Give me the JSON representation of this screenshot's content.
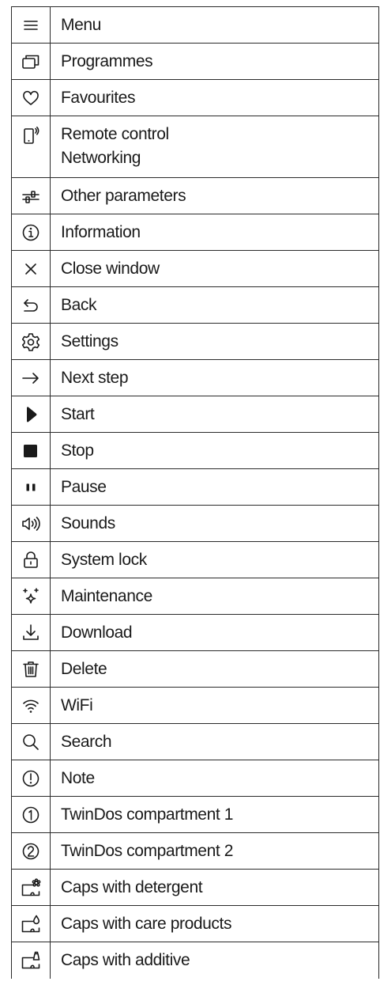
{
  "rows": [
    {
      "icon": "menu-icon",
      "label": "Menu"
    },
    {
      "icon": "programmes-icon",
      "label": "Programmes"
    },
    {
      "icon": "heart-icon",
      "label": "Favourites"
    },
    {
      "icon": "remote-control-icon",
      "label": "Remote control",
      "label2": "Networking"
    },
    {
      "icon": "parameters-icon",
      "label": "Other parameters"
    },
    {
      "icon": "information-icon",
      "label": "Information"
    },
    {
      "icon": "close-icon",
      "label": "Close window"
    },
    {
      "icon": "back-arrow-icon",
      "label": "Back"
    },
    {
      "icon": "gear-icon",
      "label": "Settings"
    },
    {
      "icon": "right-arrow-icon",
      "label": "Next step"
    },
    {
      "icon": "play-icon",
      "label": "Start"
    },
    {
      "icon": "stop-icon",
      "label": "Stop"
    },
    {
      "icon": "pause-icon",
      "label": "Pause"
    },
    {
      "icon": "speaker-icon",
      "label": "Sounds"
    },
    {
      "icon": "padlock-icon",
      "label": "System lock"
    },
    {
      "icon": "sparkle-icon",
      "label": "Maintenance"
    },
    {
      "icon": "download-icon",
      "label": "Download"
    },
    {
      "icon": "trash-icon",
      "label": "Delete"
    },
    {
      "icon": "wifi-icon",
      "label": "WiFi"
    },
    {
      "icon": "search-icon",
      "label": "Search"
    },
    {
      "icon": "exclamation-circle-icon",
      "label": "Note"
    },
    {
      "icon": "circled-one-icon",
      "label": "TwinDos compartment 1"
    },
    {
      "icon": "circled-two-icon",
      "label": "TwinDos compartment 2"
    },
    {
      "icon": "caps-detergent-icon",
      "label": "Caps with detergent"
    },
    {
      "icon": "caps-care-icon",
      "label": "Caps with care products"
    },
    {
      "icon": "caps-additive-icon",
      "label": "Caps with additive"
    }
  ]
}
